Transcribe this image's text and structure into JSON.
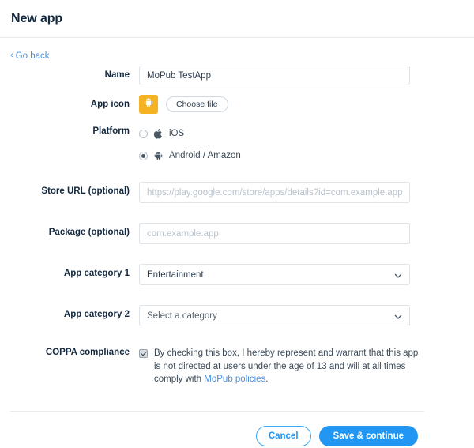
{
  "header": {
    "title": "New app"
  },
  "nav": {
    "go_back_label": "Go back",
    "go_back_chevron": "‹"
  },
  "form": {
    "name": {
      "label": "Name",
      "value": "MoPub TestApp"
    },
    "app_icon": {
      "label": "App icon",
      "icon_name": "android-robot-icon",
      "icon_bg_color": "#f5b222",
      "choose_file_label": "Choose file"
    },
    "platform": {
      "label": "Platform",
      "options": [
        {
          "label": "iOS",
          "icon": "apple-icon",
          "selected": false
        },
        {
          "label": "Android / Amazon",
          "icon": "android-icon",
          "selected": true
        }
      ]
    },
    "store_url": {
      "label": "Store URL (optional)",
      "value": "",
      "placeholder": "https://play.google.com/store/apps/details?id=com.example.app"
    },
    "package": {
      "label": "Package (optional)",
      "value": "",
      "placeholder": "com.example.app"
    },
    "app_category_1": {
      "label": "App category 1",
      "selected": "Entertainment"
    },
    "app_category_2": {
      "label": "App category 2",
      "selected": "Select a category"
    },
    "coppa": {
      "label": "COPPA compliance",
      "checked": true,
      "text_before": "By checking this box, I hereby represent and warrant that this app is not directed at users under the age of 13 and will at all times comply with ",
      "link_text": "MoPub policies",
      "text_after": "."
    }
  },
  "footer": {
    "cancel_label": "Cancel",
    "save_label": "Save & continue"
  },
  "colors": {
    "accent_blue": "#2196f3",
    "link_blue": "#4a90e2",
    "icon_orange": "#f5b222",
    "border_gray": "#dfe4e9"
  }
}
